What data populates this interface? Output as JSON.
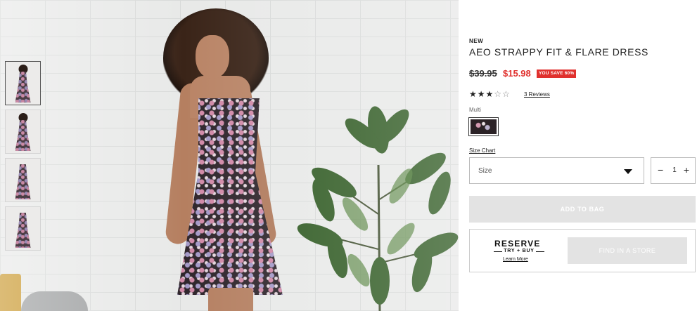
{
  "product": {
    "badge": "NEW",
    "title": "AEO STRAPPY FIT & FLARE DRESS",
    "price_original": "$39.95",
    "price_sale": "$15.98",
    "savings_tag": "YOU SAVE 60%",
    "rating": {
      "filled_stars": "★★★",
      "empty_stars": "☆☆",
      "value": 3,
      "max": 5
    },
    "reviews_link": "3 Reviews",
    "color_label": "Multi"
  },
  "size": {
    "chart_link": "Size Chart",
    "placeholder": "Size"
  },
  "quantity": {
    "minus": "−",
    "value": "1",
    "plus": "+"
  },
  "actions": {
    "add_to_bag": "ADD TO BAG",
    "find_in_store": "FIND IN A STORE"
  },
  "reserve": {
    "title": "RESERVE",
    "subtitle": "TRY + BUY",
    "learn_more": "Learn More"
  },
  "colors": {
    "sale_red": "#e0312e",
    "disabled_button": "#e3e3e3"
  }
}
